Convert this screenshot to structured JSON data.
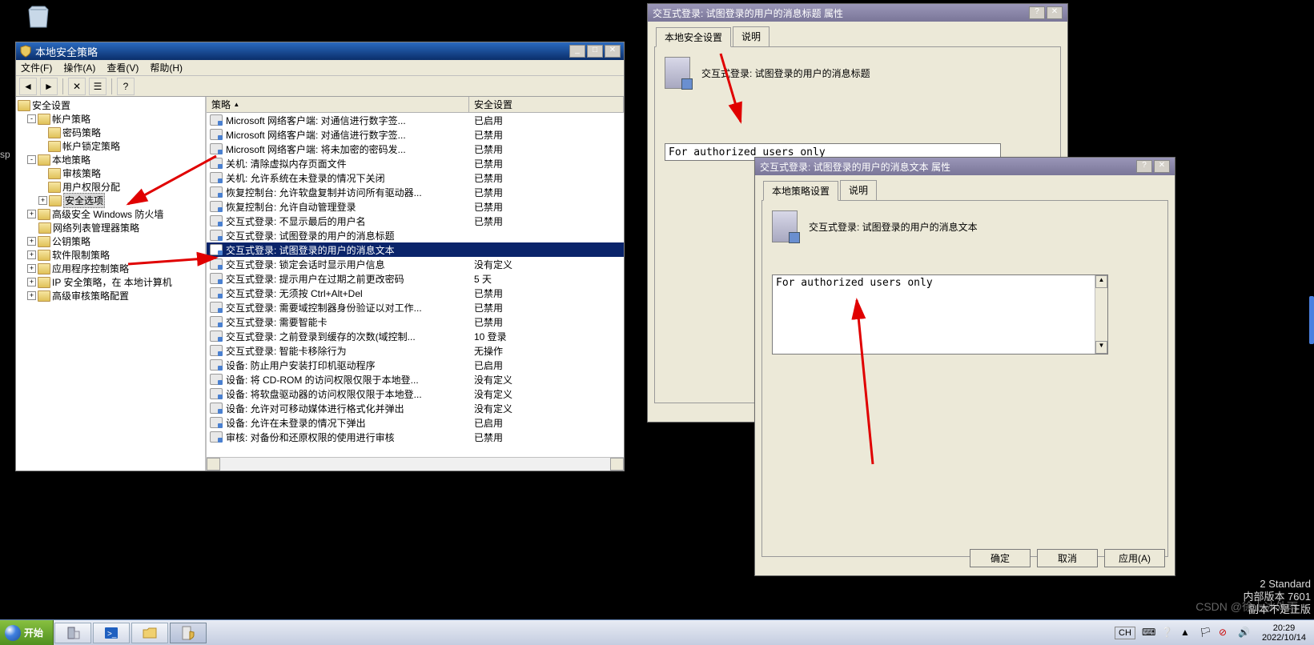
{
  "desktop": {
    "sp": "sp"
  },
  "mmc": {
    "title": "本地安全策略",
    "menu": {
      "file": "文件(F)",
      "action": "操作(A)",
      "view": "查看(V)",
      "help": "帮助(H)"
    },
    "tree": {
      "root": "安全设置",
      "account": "帐户策略",
      "password": "密码策略",
      "lockout": "帐户锁定策略",
      "local": "本地策略",
      "audit": "审核策略",
      "user_rights": "用户权限分配",
      "security_options": "安全选项",
      "firewall": "高级安全 Windows 防火墙",
      "netlist": "网络列表管理器策略",
      "pubkey": "公钥策略",
      "software": "软件限制策略",
      "appctrl": "应用程序控制策略",
      "ipsec": "IP 安全策略，在 本地计算机",
      "advaudit": "高级审核策略配置"
    },
    "list": {
      "col_policy": "策略",
      "col_setting": "安全设置",
      "rows": [
        {
          "p": "Microsoft 网络客户端: 对通信进行数字签...",
          "s": "已启用"
        },
        {
          "p": "Microsoft 网络客户端: 对通信进行数字签...",
          "s": "已禁用"
        },
        {
          "p": "Microsoft 网络客户端: 将未加密的密码发...",
          "s": "已禁用"
        },
        {
          "p": "关机: 清除虚拟内存页面文件",
          "s": "已禁用"
        },
        {
          "p": "关机: 允许系统在未登录的情况下关闭",
          "s": "已禁用"
        },
        {
          "p": "恢复控制台: 允许软盘复制并访问所有驱动器...",
          "s": "已禁用"
        },
        {
          "p": "恢复控制台: 允许自动管理登录",
          "s": "已禁用"
        },
        {
          "p": "交互式登录: 不显示最后的用户名",
          "s": "已禁用"
        },
        {
          "p": "交互式登录: 试图登录的用户的消息标题",
          "s": ""
        },
        {
          "p": "交互式登录: 试图登录的用户的消息文本",
          "s": "",
          "sel": true
        },
        {
          "p": "交互式登录: 锁定会话时显示用户信息",
          "s": "没有定义"
        },
        {
          "p": "交互式登录: 提示用户在过期之前更改密码",
          "s": "5 天"
        },
        {
          "p": "交互式登录: 无须按 Ctrl+Alt+Del",
          "s": "已禁用"
        },
        {
          "p": "交互式登录: 需要域控制器身份验证以对工作...",
          "s": "已禁用"
        },
        {
          "p": "交互式登录: 需要智能卡",
          "s": "已禁用"
        },
        {
          "p": "交互式登录: 之前登录到缓存的次数(域控制...",
          "s": "10 登录"
        },
        {
          "p": "交互式登录: 智能卡移除行为",
          "s": "无操作"
        },
        {
          "p": "设备: 防止用户安装打印机驱动程序",
          "s": "已启用"
        },
        {
          "p": "设备: 将 CD-ROM 的访问权限仅限于本地登...",
          "s": "没有定义"
        },
        {
          "p": "设备: 将软盘驱动器的访问权限仅限于本地登...",
          "s": "没有定义"
        },
        {
          "p": "设备: 允许对可移动媒体进行格式化并弹出",
          "s": "没有定义"
        },
        {
          "p": "设备: 允许在未登录的情况下弹出",
          "s": "已启用"
        },
        {
          "p": "审核: 对备份和还原权限的使用进行审核",
          "s": "已禁用"
        }
      ]
    }
  },
  "prop1": {
    "title": "交互式登录: 试图登录的用户的消息标题 属性",
    "tab_local": "本地安全设置",
    "tab_explain": "说明",
    "label": "交互式登录: 试图登录的用户的消息标题",
    "value": "For authorized users only"
  },
  "prop2": {
    "title": "交互式登录: 试图登录的用户的消息文本 属性",
    "tab_local": "本地策略设置",
    "tab_explain": "说明",
    "label": "交互式登录: 试图登录的用户的消息文本",
    "value": "For authorized users only",
    "btn_ok": "确定",
    "btn_cancel": "取消",
    "btn_apply": "应用(A)"
  },
  "watermark": {
    "l1": "2 Standard",
    "l2": "内部版本 7601",
    "l3": "副本不是正版"
  },
  "taskbar": {
    "start": "开始",
    "lang": "CH",
    "time": "20:29",
    "date": "2022/10/14"
  },
  "csdn": "CSDN @徐上冰外雨"
}
